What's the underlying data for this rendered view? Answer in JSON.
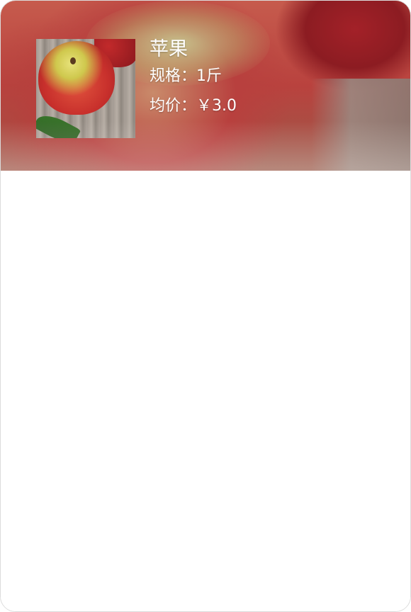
{
  "product": {
    "name": "苹果",
    "spec_label": "规格：",
    "spec_value": "1斤",
    "price_label": "均价：",
    "price_value": "￥3.0"
  },
  "images": {
    "banner": "apple-background-photo",
    "thumbnail": "apple-product-photo"
  },
  "colors": {
    "text_on_banner": "#ffffff",
    "card_border": "#dcdcdc",
    "background": "#ffffff"
  }
}
